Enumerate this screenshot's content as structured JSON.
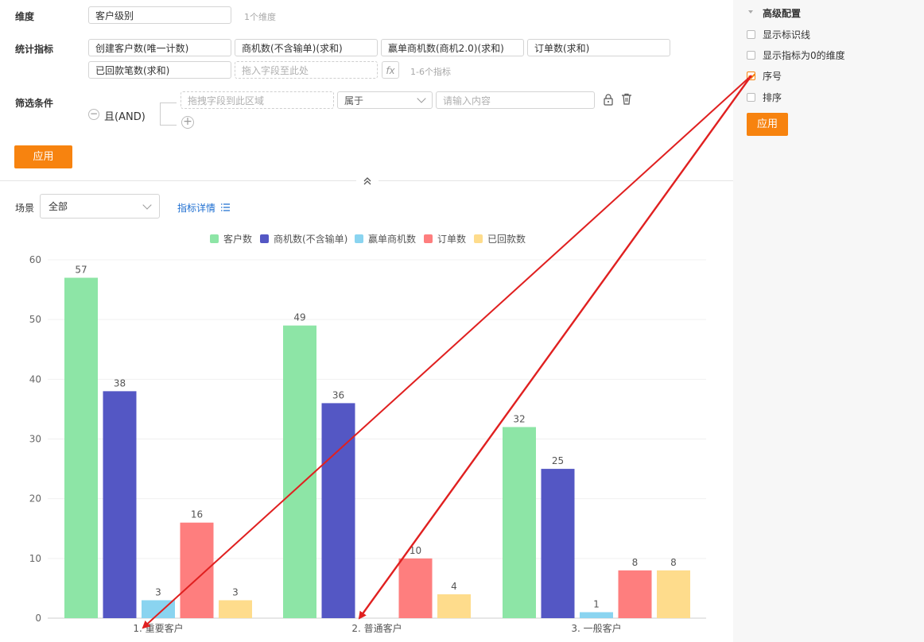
{
  "config": {
    "dimension_label": "维度",
    "dimension_value": "客户级别",
    "dimension_hint": "1个维度",
    "metrics_label": "统计指标",
    "metrics": [
      "创建客户数(唯一计数)",
      "商机数(不含输单)(求和)",
      "赢单商机数(商机2.0)(求和)",
      "订单数(求和)",
      "已回款笔数(求和)"
    ],
    "metric_drop_placeholder": "拖入字段至此处",
    "metrics_hint": "1-6个指标",
    "fx_label": "fx",
    "filter_label": "筛选条件",
    "and_label": "且(AND)",
    "filter_field_placeholder": "拖拽字段到此区域",
    "filter_operator": "属于",
    "filter_value_placeholder": "请输入内容",
    "apply_label": "应用"
  },
  "toolbar": {
    "scene_label": "场景",
    "scene_value": "全部",
    "metric_detail_label": "指标详情"
  },
  "advanced": {
    "title": "高级配置",
    "options": [
      {
        "label": "显示标识线",
        "checked": false
      },
      {
        "label": "显示指标为0的维度",
        "checked": false
      },
      {
        "label": "序号",
        "checked": true
      },
      {
        "label": "排序",
        "checked": false
      }
    ],
    "apply_label": "应用"
  },
  "colors": {
    "accent": "#f7830f",
    "link": "#1f6fd1",
    "annotation_arrow": "#e02020"
  },
  "chart_data": {
    "type": "bar",
    "categories": [
      "1. 重要客户",
      "2. 普通客户",
      "3. 一般客户"
    ],
    "series": [
      {
        "name": "客户数",
        "color": "#8de5a6",
        "values": [
          57,
          49,
          32
        ]
      },
      {
        "name": "商机数(不含输单)",
        "color": "#5457c4",
        "values": [
          38,
          36,
          25
        ]
      },
      {
        "name": "赢单商机数",
        "color": "#8ad4f0",
        "values": [
          3,
          0,
          1
        ]
      },
      {
        "name": "订单数",
        "color": "#fe7e7e",
        "values": [
          16,
          10,
          8
        ]
      },
      {
        "name": "已回款数",
        "color": "#fedc8c",
        "values": [
          3,
          4,
          8
        ]
      }
    ],
    "ylim": [
      0,
      60
    ],
    "yticks": [
      0,
      10,
      20,
      30,
      40,
      50,
      60
    ],
    "grid": true,
    "legend_position": "top-center",
    "show_value_labels": true
  }
}
